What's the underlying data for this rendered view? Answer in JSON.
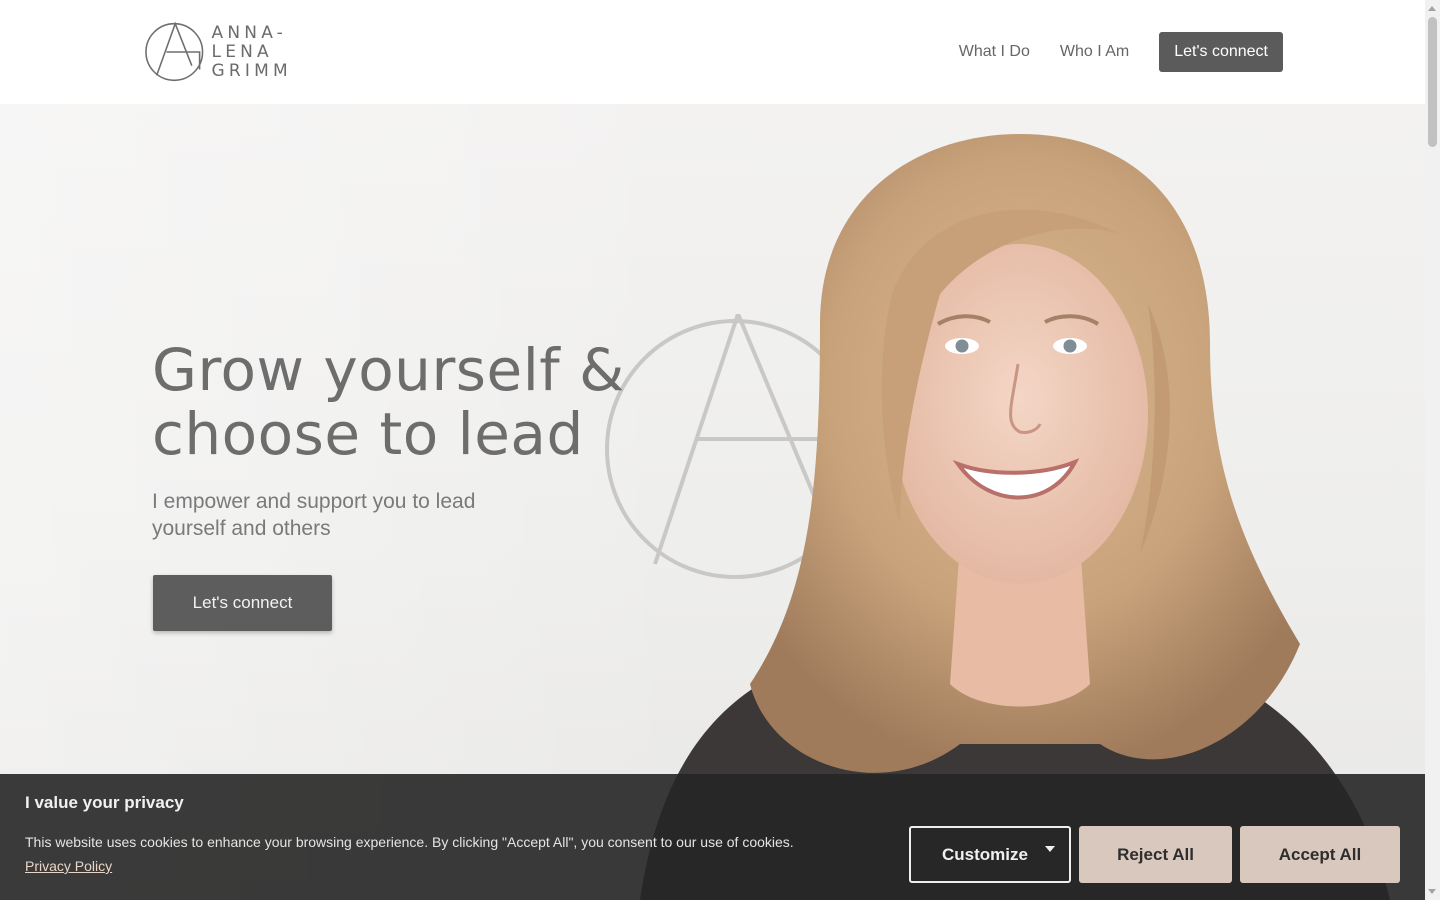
{
  "header": {
    "logo_line1": "ANNA-LENA",
    "logo_line2": "GRIMM",
    "nav": {
      "what_i_do": "What I Do",
      "who_i_am": "Who I Am",
      "cta": "Let's connect"
    }
  },
  "hero": {
    "title_line1": "Grow yourself &",
    "title_line2": "choose to lead",
    "subtitle": "I empower and support you to lead yourself and others",
    "cta": "Let's connect"
  },
  "cookie": {
    "title": "I value your privacy",
    "text": "This website uses cookies to enhance your browsing experience. By clicking \"Accept All\", you consent to our use of cookies.",
    "privacy_link": "Privacy Policy",
    "customize": "Customize",
    "reject": "Reject All",
    "accept": "Accept All"
  },
  "colors": {
    "nav_cta_bg": "#5b5b5b",
    "cookie_bg": "#262626",
    "cookie_button_bg": "#d9c8bd",
    "text_gray": "#6d6d6d"
  }
}
